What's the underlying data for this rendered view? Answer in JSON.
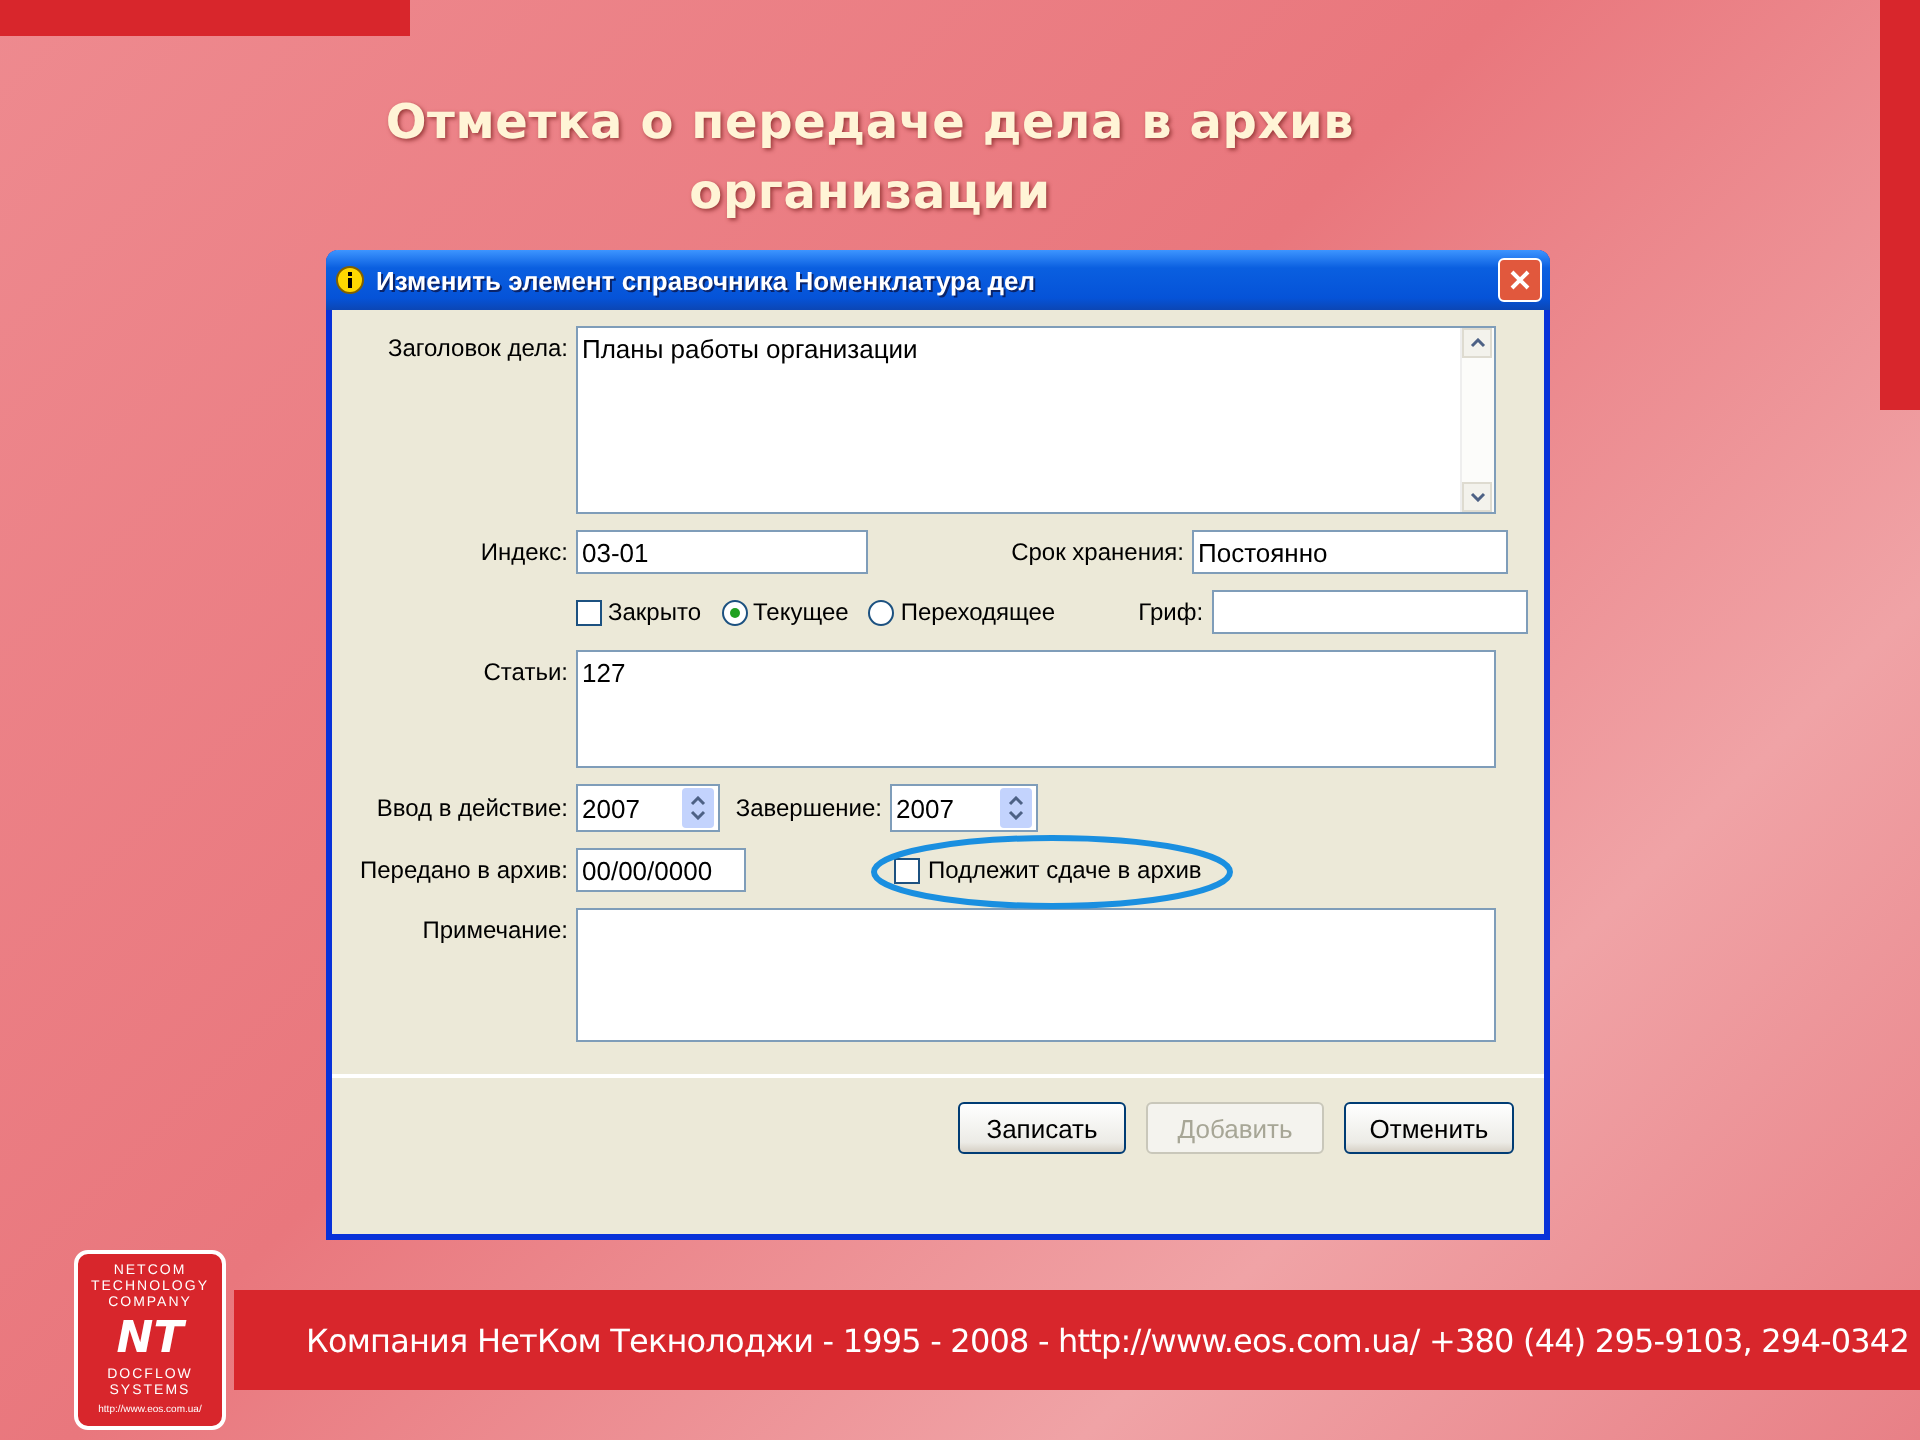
{
  "slide": {
    "title": "Отметка о передаче дела в архив организации"
  },
  "dialog": {
    "title": "Изменить элемент справочника Номенклатура дел",
    "case_title": {
      "label": "Заголовок дела:",
      "value": "Планы работы организации"
    },
    "index": {
      "label": "Индекс:",
      "value": "03-01"
    },
    "retention": {
      "label": "Срок хранения:",
      "value": "Постоянно"
    },
    "flags": [
      {
        "kind": "checkbox",
        "label": "Закрыто",
        "checked": false
      },
      {
        "kind": "radio",
        "label": "Текущее",
        "selected": true
      },
      {
        "kind": "radio",
        "label": "Переходящее",
        "selected": false
      }
    ],
    "stamp": {
      "label": "Гриф:"
    },
    "articles": {
      "label": "Статьи:",
      "value": "127"
    },
    "start": {
      "label": "Ввод в действие:",
      "value": "2007"
    },
    "end": {
      "label": "Завершение:",
      "value": "2007"
    },
    "archived": {
      "label": "Передано в архив:",
      "value": "00/00/0000"
    },
    "to_archive": {
      "label": "Подлежит сдаче в архив",
      "checked": false,
      "highlighted": true
    },
    "note": {
      "label": "Примечание:"
    },
    "buttons": [
      {
        "label": "Записать",
        "disabled": false
      },
      {
        "label": "Добавить",
        "disabled": true
      },
      {
        "label": "Отменить",
        "disabled": false
      }
    ]
  },
  "footer": {
    "logo": {
      "top": "NETCOM TECHNOLOGY COMPANY",
      "mark": "NT",
      "bottom": "DOCFLOW SYSTEMS",
      "url": "http://www.eos.com.ua/"
    },
    "line": "Компания НетКом Текнолоджи - 1995 - 2008 - http://www.eos.com.ua/ +380 (44) 295-9103, 294-0342"
  }
}
